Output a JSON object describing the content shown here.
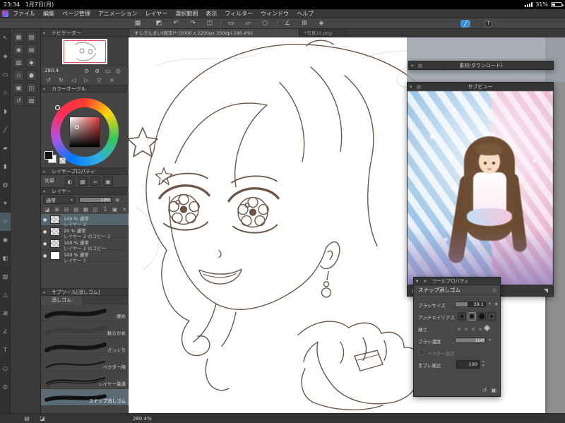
{
  "status_bar": {
    "time": "23:34",
    "date": "1月7日(月)",
    "battery_percent": "31%"
  },
  "menu_bar": {
    "items": [
      "ファイル",
      "編集",
      "ページ管理",
      "アニメーション",
      "レイヤー",
      "選択範囲",
      "表示",
      "フィルター",
      "ウィンドウ",
      "ヘルプ"
    ]
  },
  "toolbar": {
    "icons": [
      {
        "name": "palette-dock-icon",
        "glyph": "▦"
      },
      {
        "name": "edit-mode-icon",
        "glyph": "◩"
      },
      {
        "name": "undo-icon",
        "glyph": "↶"
      },
      {
        "name": "redo-icon",
        "glyph": "↷"
      },
      {
        "name": "clear-icon",
        "glyph": "◫"
      },
      {
        "name": "selection-icon",
        "glyph": "▭"
      },
      {
        "name": "transform-icon",
        "glyph": "▱"
      },
      {
        "name": "deselect-icon",
        "glyph": "○"
      },
      {
        "name": "ruler-snap-icon",
        "glyph": "∠"
      },
      {
        "name": "grid-snap-icon",
        "glyph": "⊞"
      },
      {
        "name": "special-ruler-snap-icon",
        "glyph": "◈"
      }
    ],
    "stylus_glyph": "╱",
    "help_label": "?"
  },
  "tab_bar": {
    "tabs": [
      {
        "label": "すしざんまい(仮定)* (3000 x 2250px 350dpi 280.4%)"
      },
      {
        "label": "*写真10.png"
      }
    ]
  },
  "tool_strip": {
    "icons": [
      {
        "name": "operate-tool-icon",
        "glyph": "↖"
      },
      {
        "name": "move-tool-icon",
        "glyph": "◈"
      },
      {
        "name": "marquee-select-icon",
        "glyph": "▭"
      },
      {
        "name": "auto-select-icon",
        "glyph": "☆"
      },
      {
        "name": "eyedropper-icon",
        "glyph": "◗"
      },
      {
        "name": "pen-tool-icon",
        "glyph": "╱"
      },
      {
        "name": "pencil-tool-icon",
        "glyph": "▰"
      },
      {
        "name": "brush-tool-icon",
        "glyph": "▮"
      },
      {
        "name": "airbrush-tool-icon",
        "glyph": "◍"
      },
      {
        "name": "decoration-tool-icon",
        "glyph": "∗"
      },
      {
        "name": "eraser-tool-icon",
        "glyph": "▱"
      },
      {
        "name": "blend-tool-icon",
        "glyph": "◉"
      },
      {
        "name": "fill-tool-icon",
        "glyph": "◧"
      },
      {
        "name": "gradient-tool-icon",
        "glyph": "▨"
      },
      {
        "name": "figure-tool-icon",
        "glyph": "△"
      },
      {
        "name": "frame-border-tool-icon",
        "glyph": "⊞"
      },
      {
        "name": "ruler-tool-icon",
        "glyph": "∠"
      },
      {
        "name": "text-tool-icon",
        "glyph": "T"
      },
      {
        "name": "balloon-tool-icon",
        "glyph": "○"
      },
      {
        "name": "settings-icon",
        "glyph": "◎"
      }
    ]
  },
  "dock": {
    "icons": [
      {
        "name": "quick-access-icon",
        "glyph": "▦"
      },
      {
        "name": "navigator-icon",
        "glyph": "▧"
      },
      {
        "name": "color-wheel-icon",
        "glyph": "◉"
      },
      {
        "name": "color-slider-icon",
        "glyph": "▤"
      },
      {
        "name": "color-set-icon",
        "glyph": "▥"
      },
      {
        "name": "tool-icon",
        "glyph": "◆"
      },
      {
        "name": "subtool-icon",
        "glyph": "◇"
      },
      {
        "name": "brush-size-icon",
        "glyph": "●"
      },
      {
        "name": "layer-icon",
        "glyph": "▣"
      },
      {
        "name": "layer-property-icon",
        "glyph": "◫"
      },
      {
        "name": "history-icon",
        "glyph": "↺"
      },
      {
        "name": "material-icon",
        "glyph": "▨"
      }
    ]
  },
  "navigator": {
    "title": "ナビゲーター",
    "zoom_value": "280.4",
    "zoom_icons": [
      {
        "name": "zoom-out-icon",
        "glyph": "⊖"
      },
      {
        "name": "zoom-in-icon",
        "glyph": "⊕"
      },
      {
        "name": "fit-screen-icon",
        "glyph": "▭"
      },
      {
        "name": "actual-size-icon",
        "glyph": "◎"
      }
    ],
    "rotate_icons": [
      {
        "name": "rotate-left-icon",
        "glyph": "↺"
      },
      {
        "name": "rotate-right-icon",
        "glyph": "↻"
      },
      {
        "name": "flip-horizontal-icon",
        "glyph": "◁"
      },
      {
        "name": "flip-horizontal2-icon",
        "glyph": "▷"
      },
      {
        "name": "flip-vertical-icon",
        "glyph": "▽"
      },
      {
        "name": "reset-view-icon",
        "glyph": "×"
      }
    ]
  },
  "color_panel": {
    "title": "カラーサークル"
  },
  "layer_property": {
    "title": "レイヤープロパティ",
    "effect_label": "効果",
    "icons": [
      {
        "name": "border-effect-icon",
        "glyph": "◐"
      },
      {
        "name": "tone-icon",
        "glyph": "▦"
      },
      {
        "name": "extract-line-icon",
        "glyph": "≈"
      },
      {
        "name": "expression-color-icon",
        "glyph": "▣"
      }
    ]
  },
  "layers_panel": {
    "title": "レイヤー",
    "blend_mode": "通常",
    "opacity_value": "100",
    "toolbar_icons": [
      {
        "name": "clip-icon",
        "glyph": "◪"
      },
      {
        "name": "new-layer-icon",
        "glyph": "⊞"
      },
      {
        "name": "new-folder-icon",
        "glyph": "⊟"
      },
      {
        "name": "mask-icon",
        "glyph": "▤"
      },
      {
        "name": "tone-layer-icon",
        "glyph": "▦"
      },
      {
        "name": "merge-icon",
        "glyph": "◫"
      },
      {
        "name": "transfer-down-icon",
        "glyph": "↧"
      },
      {
        "name": "palette-menu-icon",
        "glyph": "▣"
      },
      {
        "name": "delete-layer-icon",
        "glyph": "×"
      }
    ],
    "layers": [
      {
        "info": "100 % 通常",
        "name": "レイヤー 2"
      },
      {
        "info": "20 % 通常",
        "name": "レイヤー 2 のコピー 2"
      },
      {
        "info": "100 % 通常",
        "name": "レイヤー 2 のコピー"
      },
      {
        "info": "100 % 通常",
        "name": "レイヤー 1"
      }
    ]
  },
  "subtool_panel": {
    "title": "サブツール[消しゴム]",
    "group_tab": "消しゴム",
    "items": [
      {
        "label": "硬め"
      },
      {
        "label": "軟らかめ"
      },
      {
        "label": "ざっくり"
      },
      {
        "label": "ベクター用"
      },
      {
        "label": "レイヤー貫通"
      },
      {
        "label": "スナップ消しゴム"
      }
    ]
  },
  "material_panel": {
    "title": "素材(ダウンロード)"
  },
  "subview_panel": {
    "title": "サブビュー",
    "footer_icons": [
      {
        "name": "subview-switch-icon",
        "glyph": "◧"
      },
      {
        "name": "prev-image-icon",
        "glyph": "◁"
      },
      {
        "name": "next-image-icon",
        "glyph": "▷"
      },
      {
        "name": "zoom-out-icon",
        "glyph": "⊖"
      },
      {
        "name": "zoom-in-icon",
        "glyph": "⊕"
      },
      {
        "name": "eyedrop-toggle-icon",
        "glyph": "◉"
      },
      {
        "name": "expand-icon",
        "glyph": "◥"
      }
    ]
  },
  "tool_property": {
    "title": "ツールプロパティ",
    "subtool_name": "スナップ消しゴム",
    "brush_size": {
      "label": "ブラシサイズ",
      "value": "39.1"
    },
    "anti_aliasing": {
      "label": "アンチエイリアス"
    },
    "hardness": {
      "label": "硬さ"
    },
    "density": {
      "label": "ブラシ濃度",
      "value": "100"
    },
    "vector_erase": {
      "label": "ベクター消去"
    },
    "stabilization": {
      "label": "手ブレ補正",
      "value": "100"
    },
    "footer_icons": [
      {
        "name": "reset-all-icon",
        "glyph": "↺"
      },
      {
        "name": "detail-settings-icon",
        "glyph": "▣"
      }
    ]
  },
  "bottom_bar": {
    "zoom_display": "280.4%",
    "icons": [
      {
        "name": "new-subtool-icon",
        "glyph": "▤"
      },
      {
        "name": "trash-icon",
        "glyph": "◪"
      }
    ]
  },
  "colors": {
    "accent_blue": "#3f8fd4",
    "selection": "#56666e",
    "canvas_white": "#ffffff"
  }
}
